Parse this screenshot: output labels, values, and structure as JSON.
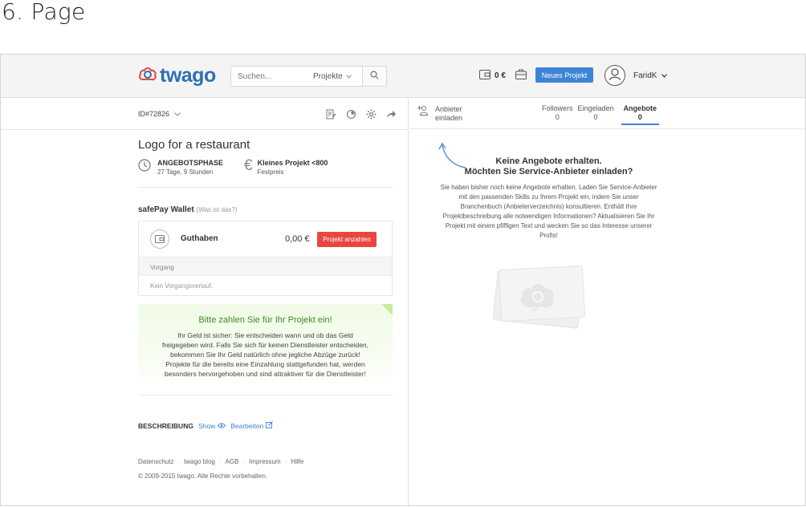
{
  "slide": {
    "title": "6. Page"
  },
  "header": {
    "logo_text": "twago",
    "search": {
      "placeholder": "Suchen...",
      "select_value": "Projekte"
    },
    "wallet_balance": "0 €",
    "new_project_label": "Neues Projekt",
    "username": "FaridK"
  },
  "project": {
    "id": "ID#72826",
    "title": "Logo for a restaurant",
    "phase_label": "ANGEBOTSPHASE",
    "phase_time": "27 Tage, 9 Stunden",
    "budget_label": "Kleines Projekt <800",
    "budget_type": "Festpreis"
  },
  "wallet": {
    "heading": "safePay Wallet",
    "help_link": "(Was ist das?)",
    "balance_label": "Guthaben",
    "balance_amount": "0,00 €",
    "pay_button": "Projekt anzahlen",
    "history_label": "Vorgang",
    "history_empty": "Kein Vorgangsverlauf."
  },
  "notice": {
    "title": "Bitte zahlen Sie für Ihr Projekt ein!",
    "lines": [
      "Ihr Geld ist sicher: Sie entscheiden wann und ob das Geld",
      "freigegeben wird. Falls Sie sich für keinen Dienstleister entscheiden,",
      "bekommen Sie Ihr Geld natürlich ohne jegliche Abzüge zurück!",
      "Projekte für die bereits eine Einzahlung stattgefunden hat, werden",
      "besonders hervorgehoben und sind attraktiver für die Dienstleister!"
    ]
  },
  "description": {
    "label": "BESCHREIBUNG",
    "show": "Show",
    "edit": "Bearbeiten"
  },
  "footer": {
    "links": [
      "Datenschutz",
      "twago blog",
      "AGB",
      "Impressum",
      "Hilfe"
    ],
    "separator": "·",
    "copyright": "© 2009-2015 twago. Alle Rechte vorbehalten."
  },
  "offers": {
    "invite_line1": "Anbieter",
    "invite_line2": "einladen",
    "tabs": [
      {
        "label": "Followers",
        "count": "0"
      },
      {
        "label": "Eingeladen",
        "count": "0"
      },
      {
        "label": "Angebote",
        "count": "0",
        "active": true
      }
    ],
    "empty_title_line1": "Keine Angebote erhalten.",
    "empty_title_line2": "Möchten Sie Service-Anbieter einladen?",
    "empty_lines": [
      "Sie haben bisher noch keine Angebote erhalten. Laden Sie Service-Anbieter",
      "mit den passenden Skills zu Ihrem Projekt ein, indem Sie unser",
      "Branchenbuch (Anbieterverzeichnis) konsultieren. Enthält Ihre",
      "Projektbeschreibung alle notwendigen Informationen? Aktualisieren Sie Ihr",
      "Projekt mit einem pfiffigen Text und wecken Sie so das Interesse unserer",
      "Profis!"
    ]
  },
  "colors": {
    "brand_blue": "#2f6fb5",
    "button_blue": "#3d84d6",
    "pay_red": "#e8473f",
    "notice_green": "#3d8b2a"
  }
}
